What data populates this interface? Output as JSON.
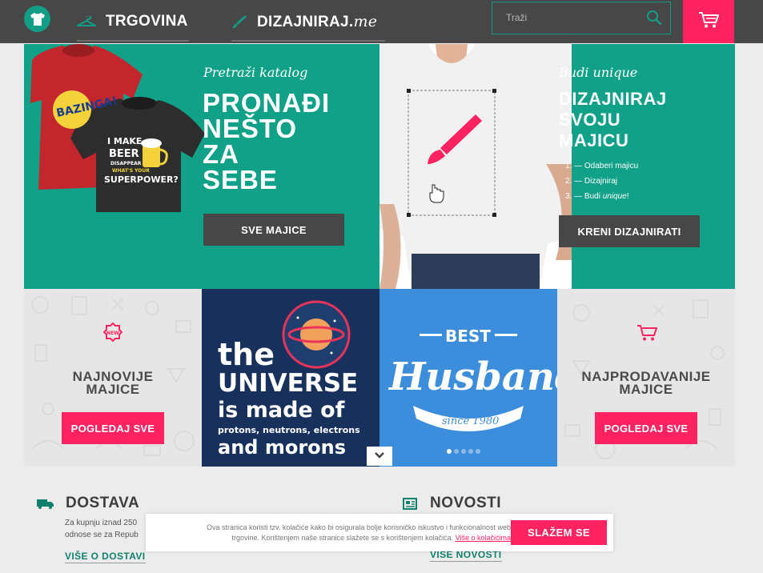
{
  "header": {
    "nav_shop": "TRGOVINA",
    "nav_design_main": "DIZAJNIRAJ.",
    "nav_design_suffix": "me",
    "search_placeholder": "Traži"
  },
  "hero": {
    "left": {
      "script": "Pretraži katalog",
      "headline": [
        "PRONAĐI",
        "NEŠTO",
        "ZA",
        "SEBE"
      ],
      "button": "SVE MAJICE",
      "shirt_front_texts": [
        "BAZINGA!"
      ],
      "shirt_back_texts": [
        "I MAKE",
        "BEER",
        "DISAPPEAR",
        "WHAT'S YOUR",
        "SUPERPOWER?"
      ]
    },
    "right": {
      "script": "Budi unique",
      "headline": [
        "DIZAJNIRAJ",
        "SVOJU",
        "MAJICU"
      ],
      "steps": [
        "1. — Odaberi majicu",
        "2. — Dizajniraj",
        "3. — Budi "
      ],
      "steps_em": "unique",
      "steps_tail": "!",
      "button": "KRENI DIZAJNIRATI"
    }
  },
  "tiles": {
    "newest": {
      "badge": "NEW",
      "title_1": "NAJNOVIJE",
      "title_2": "MAJICE",
      "button": "POGLEDAJ SVE"
    },
    "universe": {
      "line1": "the",
      "line2": "UNIVERSE",
      "line3": "is made of",
      "line4": "protons, neutrons, electrons",
      "line5": "and morons"
    },
    "husband": {
      "top": "BEST",
      "script": "Husband",
      "ribbon": "since 1980",
      "slide_count": 5,
      "active_slide": 1
    },
    "bestsellers": {
      "title_1": "NAJPRODAVANIJE",
      "title_2": "MAJICE",
      "button": "POGLEDAJ SVE"
    }
  },
  "info": {
    "shipping": {
      "title": "DOSTAVA",
      "line1": "Za kupnju iznad 250",
      "line2": "odnose se za Repub",
      "more": "VIŠE O DOSTAVI"
    },
    "news": {
      "title": "NOVOSTI",
      "more": "VIŠE NOVOSTI"
    }
  },
  "cookie": {
    "text1": "Ova stranica koristi tzv. kolačiće kako bi osigurala bolje korisničko iskustvo i funkcionalnost web",
    "text2": "trgovine. Korištenjem naše stranice slažete se s korištenjem kolačića.",
    "link": "Više o kolačićima",
    "accept": "SLAŽEM SE"
  },
  "colors": {
    "teal": "#11a088",
    "pink": "#fe2260",
    "dark": "#474747",
    "navy": "#18315c",
    "blue": "#3c8ddb"
  }
}
